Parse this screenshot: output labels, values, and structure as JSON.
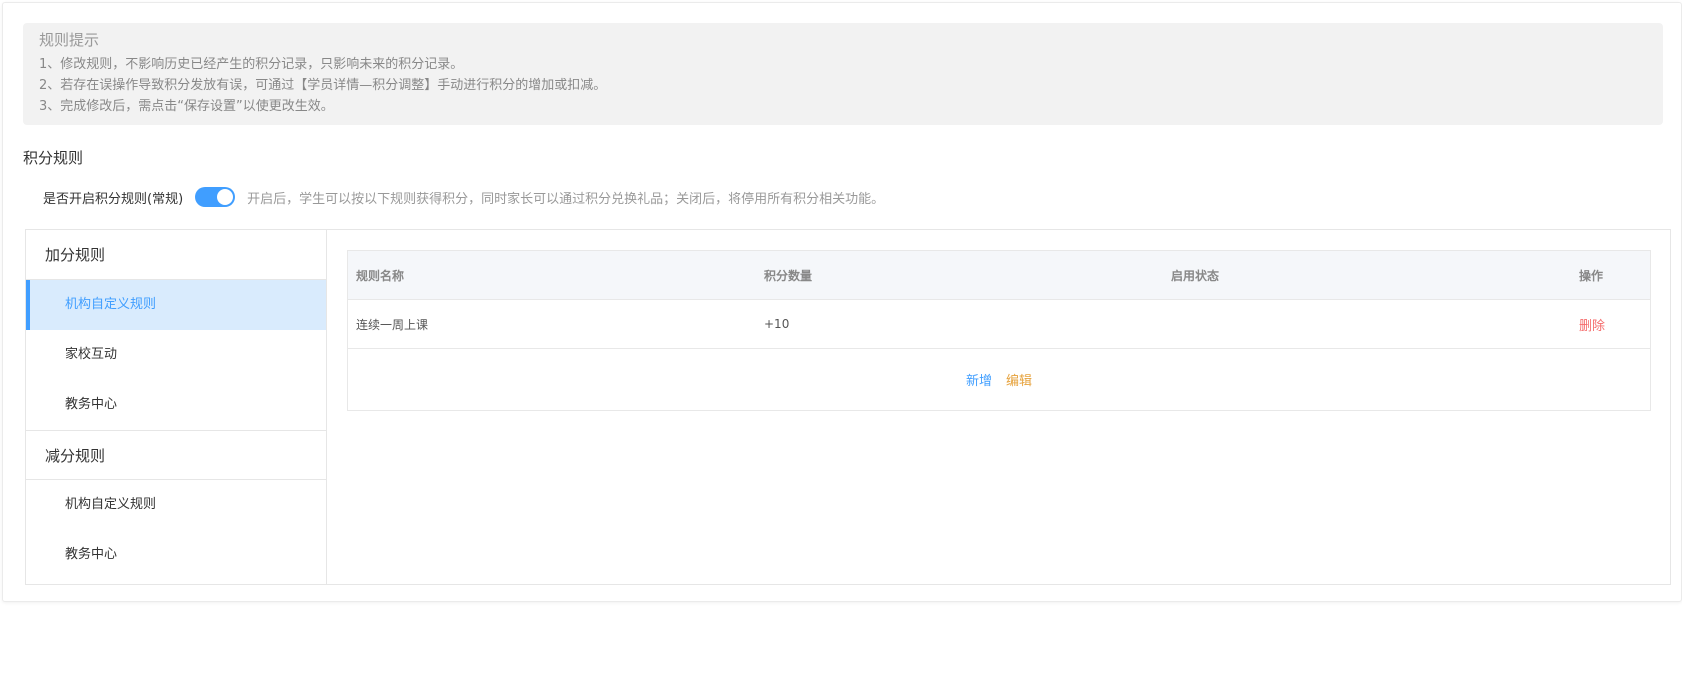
{
  "tips": {
    "title": "规则提示",
    "lines": [
      "1、修改规则，不影响历史已经产生的积分记录，只影响未来的积分记录。",
      "2、若存在误操作导致积分发放有误，可通过【学员详情—积分调整】手动进行积分的增加或扣减。",
      "3、完成修改后，需点击“保存设置”以使更改生效。"
    ]
  },
  "section_title": "积分规则",
  "switch": {
    "label": "是否开启积分规则(常规)",
    "enabled": true,
    "description": "开启后，学生可以按以下规则获得积分，同时家长可以通过积分兑换礼品；关闭后，将停用所有积分相关功能。"
  },
  "sidebar": {
    "groups": [
      {
        "title": "加分规则",
        "items": [
          "机构自定义规则",
          "家校互动",
          "教务中心"
        ],
        "active_index": 0
      },
      {
        "title": "减分规则",
        "items": [
          "机构自定义规则",
          "教务中心"
        ]
      }
    ]
  },
  "table": {
    "headers": [
      "规则名称",
      "积分数量",
      "启用状态",
      "操作"
    ],
    "rows": [
      {
        "name": "连续一周上课",
        "points": "+10",
        "enabled": true,
        "action": "删除"
      }
    ],
    "add_label": "新增",
    "edit_label": "编辑"
  },
  "colors": {
    "accent": "#409eff",
    "danger": "#f56c6c",
    "warning": "#e6a23c",
    "active_bg": "#d9ebfd"
  }
}
